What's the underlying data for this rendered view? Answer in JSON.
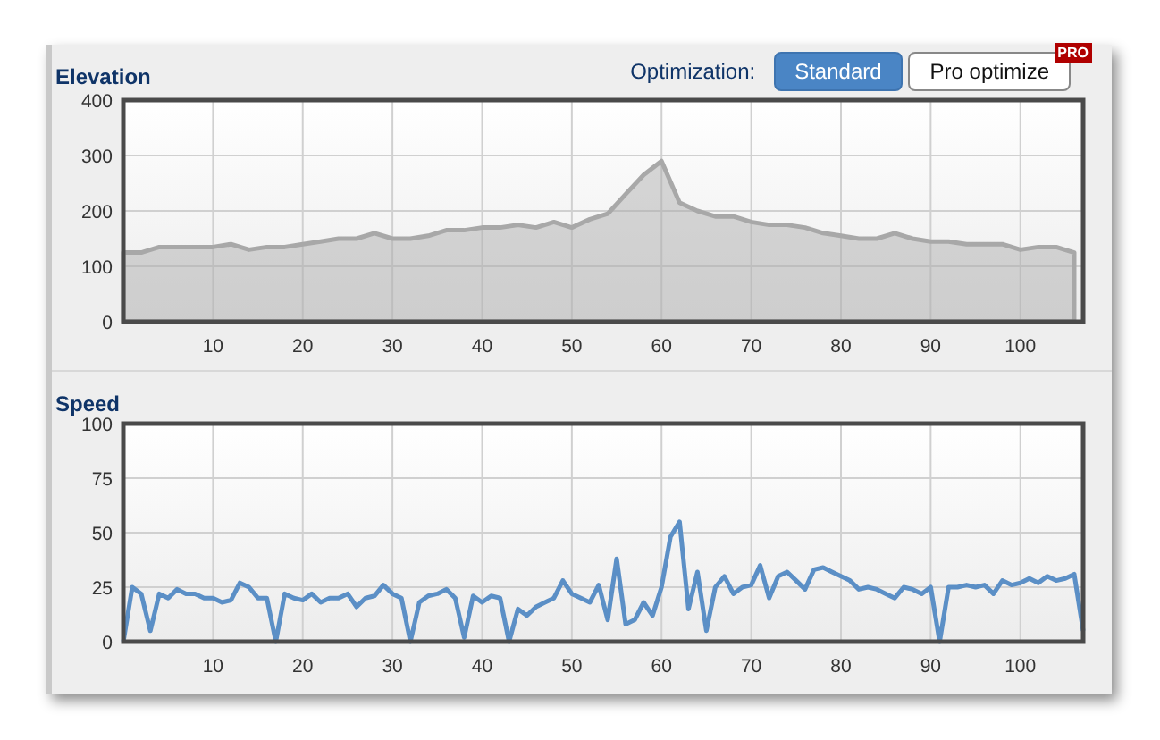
{
  "optimization": {
    "label": "Optimization:",
    "options": [
      {
        "label": "Standard",
        "selected": true
      },
      {
        "label": "Pro optimize",
        "selected": false,
        "badge": "PRO"
      }
    ]
  },
  "elevation": {
    "chart_data": {
      "type": "area",
      "title": "Elevation",
      "xlim": [
        0,
        107
      ],
      "ylim": [
        0,
        400
      ],
      "xticks": [
        10,
        20,
        30,
        40,
        50,
        60,
        70,
        80,
        90,
        100
      ],
      "yticks": [
        0,
        100,
        200,
        300,
        400
      ],
      "x": [
        0,
        2,
        4,
        6,
        8,
        10,
        12,
        14,
        16,
        18,
        20,
        22,
        24,
        26,
        28,
        30,
        32,
        34,
        36,
        38,
        40,
        42,
        44,
        46,
        48,
        50,
        52,
        54,
        56,
        58,
        60,
        62,
        64,
        66,
        68,
        70,
        72,
        74,
        76,
        78,
        80,
        82,
        84,
        86,
        88,
        90,
        92,
        94,
        96,
        98,
        100,
        102,
        104,
        106
      ],
      "grid": true,
      "series": [
        {
          "color": "#a8a8a8",
          "values": [
            125,
            125,
            135,
            135,
            135,
            135,
            140,
            130,
            135,
            135,
            140,
            145,
            150,
            150,
            160,
            150,
            150,
            155,
            165,
            165,
            170,
            170,
            175,
            170,
            180,
            170,
            185,
            195,
            230,
            265,
            290,
            215,
            200,
            190,
            190,
            180,
            175,
            175,
            170,
            160,
            155,
            150,
            150,
            160,
            150,
            145,
            145,
            140,
            140,
            140,
            130,
            135,
            135,
            125
          ]
        }
      ]
    }
  },
  "speed": {
    "chart_data": {
      "type": "line",
      "title": "Speed",
      "xlim": [
        0,
        107
      ],
      "ylim": [
        0,
        100
      ],
      "xticks": [
        10,
        20,
        30,
        40,
        50,
        60,
        70,
        80,
        90,
        100
      ],
      "yticks": [
        0,
        25,
        50,
        75,
        100
      ],
      "x": [
        0,
        1,
        2,
        3,
        4,
        5,
        6,
        7,
        8,
        9,
        10,
        11,
        12,
        13,
        14,
        15,
        16,
        17,
        18,
        19,
        20,
        21,
        22,
        23,
        24,
        25,
        26,
        27,
        28,
        29,
        30,
        31,
        32,
        33,
        34,
        35,
        36,
        37,
        38,
        39,
        40,
        41,
        42,
        43,
        44,
        45,
        46,
        47,
        48,
        49,
        50,
        51,
        52,
        53,
        54,
        55,
        56,
        57,
        58,
        59,
        60,
        61,
        62,
        63,
        64,
        65,
        66,
        67,
        68,
        69,
        70,
        71,
        72,
        73,
        74,
        75,
        76,
        77,
        78,
        79,
        80,
        81,
        82,
        83,
        84,
        85,
        86,
        87,
        88,
        89,
        90,
        91,
        92,
        93,
        94,
        95,
        96,
        97,
        98,
        99,
        100,
        101,
        102,
        103,
        104,
        105,
        106,
        107
      ],
      "grid": true,
      "series": [
        {
          "color": "#5b8fc6",
          "values": [
            0,
            25,
            22,
            5,
            22,
            20,
            24,
            22,
            22,
            20,
            20,
            18,
            19,
            27,
            25,
            20,
            20,
            0,
            22,
            20,
            19,
            22,
            18,
            20,
            20,
            22,
            16,
            20,
            21,
            26,
            22,
            20,
            0,
            18,
            21,
            22,
            24,
            20,
            2,
            21,
            18,
            21,
            20,
            0,
            15,
            12,
            16,
            18,
            20,
            28,
            22,
            20,
            18,
            26,
            10,
            38,
            8,
            10,
            18,
            12,
            25,
            48,
            55,
            15,
            32,
            5,
            25,
            30,
            22,
            25,
            26,
            35,
            20,
            30,
            32,
            28,
            24,
            33,
            34,
            32,
            30,
            28,
            24,
            25,
            24,
            22,
            20,
            25,
            24,
            22,
            25,
            0,
            25,
            25,
            26,
            25,
            26,
            22,
            28,
            26,
            27,
            29,
            27,
            30,
            28,
            29,
            31,
            5
          ]
        }
      ]
    }
  }
}
